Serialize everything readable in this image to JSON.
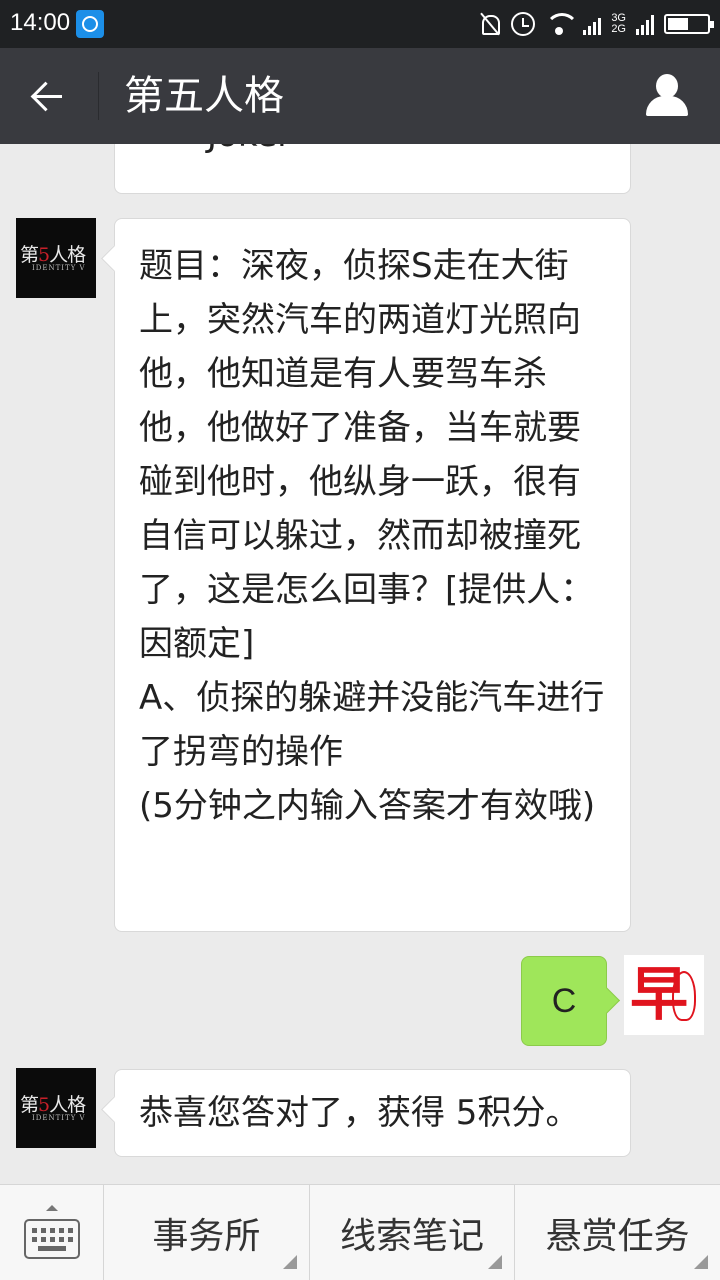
{
  "status_bar": {
    "time": "14:00",
    "network_top": "3G",
    "network_bottom": "2G"
  },
  "header": {
    "title": "第五人格"
  },
  "messages": {
    "previous_tail": "——Joker",
    "question": "题目：深夜，侦探S走在大街上，突然汽车的两道灯光照向他，他知道是有人要驾车杀他，他做好了准备，当车就要碰到他时，他纵身一跃，很有自信可以躲过，然而却被撞死了，这是怎么回事？[提供人：因额定]\nA、侦探的躲避并没能汽车进行了拐弯的操作\n(5分钟之内输入答案才有效哦)",
    "user_reply": "C",
    "result": "恭喜您答对了，获得 5积分。"
  },
  "avatars": {
    "game_logo_left": "第",
    "game_logo_num": "5",
    "game_logo_right": "人格",
    "game_logo_sub": "IDENTITY V",
    "user_mark": "早"
  },
  "bottom_menu": {
    "items": [
      "事务所",
      "线索笔记",
      "悬赏任务"
    ]
  },
  "colors": {
    "titlebar": "#393a3f",
    "statusbar": "#1f2123",
    "user_bubble": "#9fe65a",
    "background": "#ebebeb"
  }
}
